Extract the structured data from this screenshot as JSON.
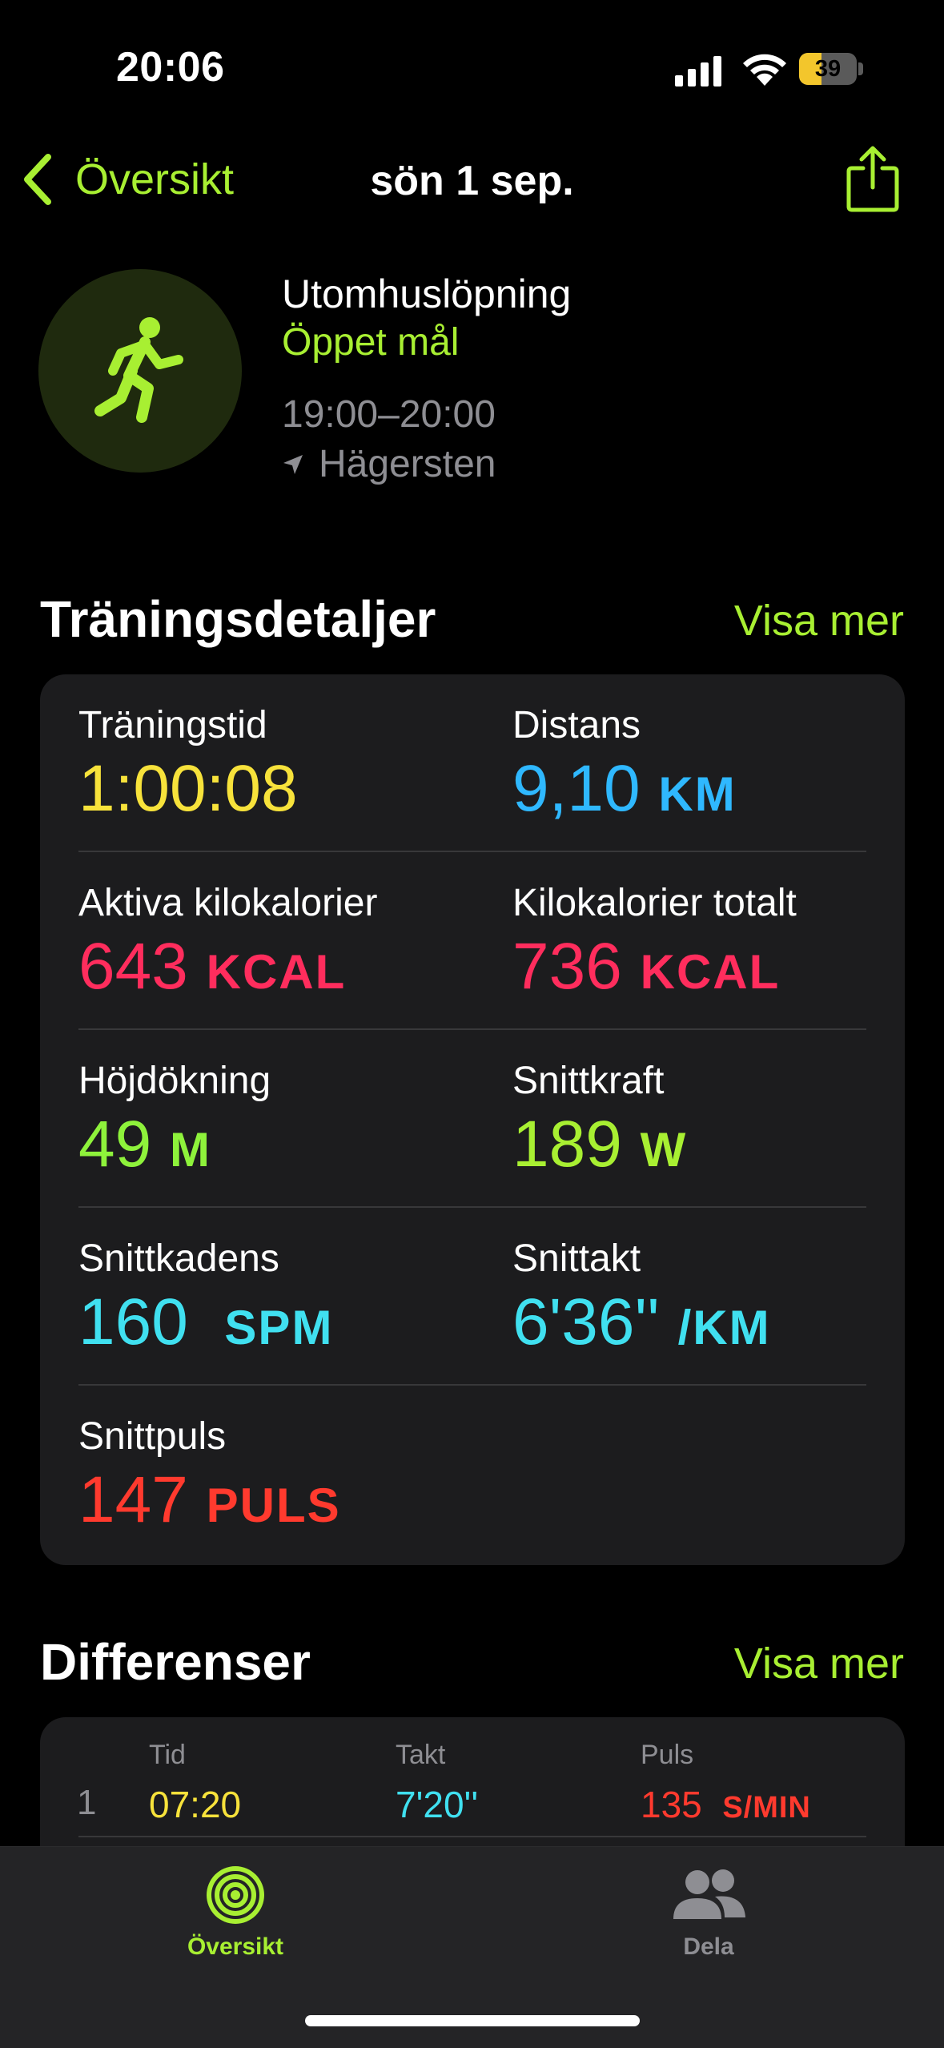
{
  "status": {
    "time": "20:06",
    "battery": "39"
  },
  "nav": {
    "back_label": "Översikt",
    "title": "sön 1 sep."
  },
  "workout": {
    "type": "Utomhuslöpning",
    "goal": "Öppet mål",
    "time_range": "19:00–20:00",
    "location": "Hägersten"
  },
  "details": {
    "title": "Träningsdetaljer",
    "more": "Visa mer",
    "metrics": [
      {
        "label": "Träningstid",
        "value": "1:00:08",
        "unit": ""
      },
      {
        "label": "Distans",
        "value": "9,10",
        "unit": "KM"
      },
      {
        "label": "Aktiva kilokalorier",
        "value": "643",
        "unit": "KCAL"
      },
      {
        "label": "Kilokalorier totalt",
        "value": "736",
        "unit": "KCAL"
      },
      {
        "label": "Höjdökning",
        "value": "49",
        "unit": "M"
      },
      {
        "label": "Snittkraft",
        "value": "189",
        "unit": "W"
      },
      {
        "label": "Snittkadens",
        "value": "160",
        "unit": "SPM"
      },
      {
        "label": "Snittakt",
        "value": "6'36''",
        "unit": "/KM"
      },
      {
        "label": "Snittpuls",
        "value": "147",
        "unit": "PULS"
      }
    ]
  },
  "splits": {
    "title": "Differenser",
    "more": "Visa mer",
    "columns": [
      "Tid",
      "Takt",
      "Puls"
    ],
    "rows": [
      {
        "n": "1",
        "time": "07:20",
        "pace": "7'20''",
        "hr": "135",
        "hr_unit": "S/MIN"
      }
    ]
  },
  "tabs": [
    {
      "label": "Översikt"
    },
    {
      "label": "Dela"
    }
  ],
  "colors": {
    "accent": "#a8ef32",
    "time": "#f7e23b",
    "distance": "#2fb8ff",
    "calories": "#ff2d5d",
    "elevation": "#8ef23b",
    "cadence": "#40e0f0",
    "heart": "#ff3a2e"
  }
}
